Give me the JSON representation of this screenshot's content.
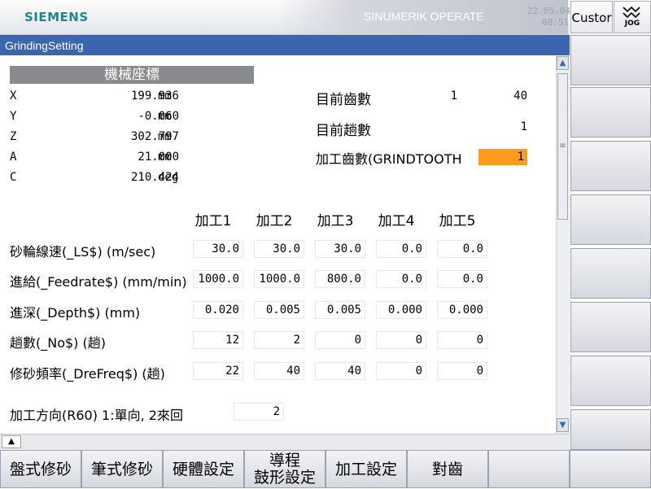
{
  "header": {
    "brand": "SIEMENS",
    "product": "SINUMERIK OPERATE",
    "date": "22.05.04",
    "time": "08:51",
    "custom_label": "Custor",
    "mode_label": "JOG"
  },
  "window": {
    "title": "GrindingSetting"
  },
  "machine_coords": {
    "header": "機械座標",
    "axes": [
      {
        "name": "X",
        "value": "199.936",
        "unit": "mm"
      },
      {
        "name": "Y",
        "value": "-0.060",
        "unit": "mm"
      },
      {
        "name": "Z",
        "value": "302.797",
        "unit": "mm"
      },
      {
        "name": "A",
        "value": "21.000",
        "unit": "mm"
      },
      {
        "name": "C",
        "value": "210.424",
        "unit": "deg"
      }
    ]
  },
  "status": {
    "current_tooth_label": "目前齒數",
    "current_tooth_value": "1",
    "current_tooth_total": "40",
    "current_pass_label": "目前趟數",
    "current_pass_value": "1",
    "grind_tooth_label": "加工齒數(GRINDTOOTH",
    "grind_tooth_value": "1"
  },
  "table": {
    "columns": [
      "加工1",
      "加工2",
      "加工3",
      "加工4",
      "加工5"
    ],
    "rows": [
      {
        "label": "砂輪線速(_LS$) (m/sec)",
        "values": [
          "30.0",
          "30.0",
          "30.0",
          "0.0",
          "0.0"
        ]
      },
      {
        "label": "進給(_Feedrate$) (mm/min)",
        "values": [
          "1000.0",
          "1000.0",
          "800.0",
          "0.0",
          "0.0"
        ]
      },
      {
        "label": "進深(_Depth$) (mm)",
        "values": [
          "0.020",
          "0.005",
          "0.005",
          "0.000",
          "0.000"
        ]
      },
      {
        "label": "趟數(_No$) (趟)",
        "values": [
          "12",
          "2",
          "0",
          "0",
          "0"
        ]
      },
      {
        "label": "修砂頻率(_DreFreq$) (趟)",
        "values": [
          "22",
          "40",
          "40",
          "0",
          "0"
        ]
      }
    ]
  },
  "direction": {
    "label": "加工方向(R60) 1:單向, 2來回",
    "value": "2"
  },
  "softkeys": {
    "horizontal": [
      {
        "line1": "盤式修砂",
        "line2": ""
      },
      {
        "line1": "筆式修砂",
        "line2": ""
      },
      {
        "line1": "硬體設定",
        "line2": ""
      },
      {
        "line1": "導程",
        "line2": "鼓形設定"
      },
      {
        "line1": "加工設定",
        "line2": ""
      },
      {
        "line1": "對齒",
        "line2": ""
      },
      {
        "line1": "",
        "line2": ""
      }
    ]
  }
}
